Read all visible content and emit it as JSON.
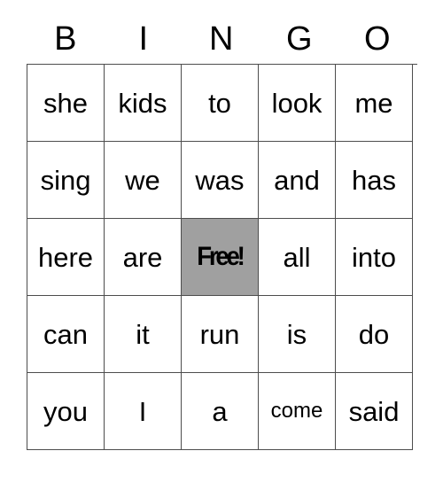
{
  "card": {
    "headers": [
      "B",
      "I",
      "N",
      "G",
      "O"
    ],
    "free_space_color": "#a0a0a0",
    "grid_line_color": "#4d4d4d",
    "rows": [
      [
        {
          "text": "she",
          "free": false,
          "shrink": false
        },
        {
          "text": "kids",
          "free": false,
          "shrink": false
        },
        {
          "text": "to",
          "free": false,
          "shrink": false
        },
        {
          "text": "look",
          "free": false,
          "shrink": false
        },
        {
          "text": "me",
          "free": false,
          "shrink": false
        }
      ],
      [
        {
          "text": "sing",
          "free": false,
          "shrink": false
        },
        {
          "text": "we",
          "free": false,
          "shrink": false
        },
        {
          "text": "was",
          "free": false,
          "shrink": false
        },
        {
          "text": "and",
          "free": false,
          "shrink": false
        },
        {
          "text": "has",
          "free": false,
          "shrink": false
        }
      ],
      [
        {
          "text": "here",
          "free": false,
          "shrink": false
        },
        {
          "text": "are",
          "free": false,
          "shrink": false
        },
        {
          "text": "Free!",
          "free": true,
          "shrink": false
        },
        {
          "text": "all",
          "free": false,
          "shrink": false
        },
        {
          "text": "into",
          "free": false,
          "shrink": false
        }
      ],
      [
        {
          "text": "can",
          "free": false,
          "shrink": false
        },
        {
          "text": "it",
          "free": false,
          "shrink": false
        },
        {
          "text": "run",
          "free": false,
          "shrink": false
        },
        {
          "text": "is",
          "free": false,
          "shrink": false
        },
        {
          "text": "do",
          "free": false,
          "shrink": false
        }
      ],
      [
        {
          "text": "you",
          "free": false,
          "shrink": false
        },
        {
          "text": "I",
          "free": false,
          "shrink": false
        },
        {
          "text": "a",
          "free": false,
          "shrink": false
        },
        {
          "text": "come",
          "free": false,
          "shrink": true
        },
        {
          "text": "said",
          "free": false,
          "shrink": false
        }
      ]
    ]
  }
}
